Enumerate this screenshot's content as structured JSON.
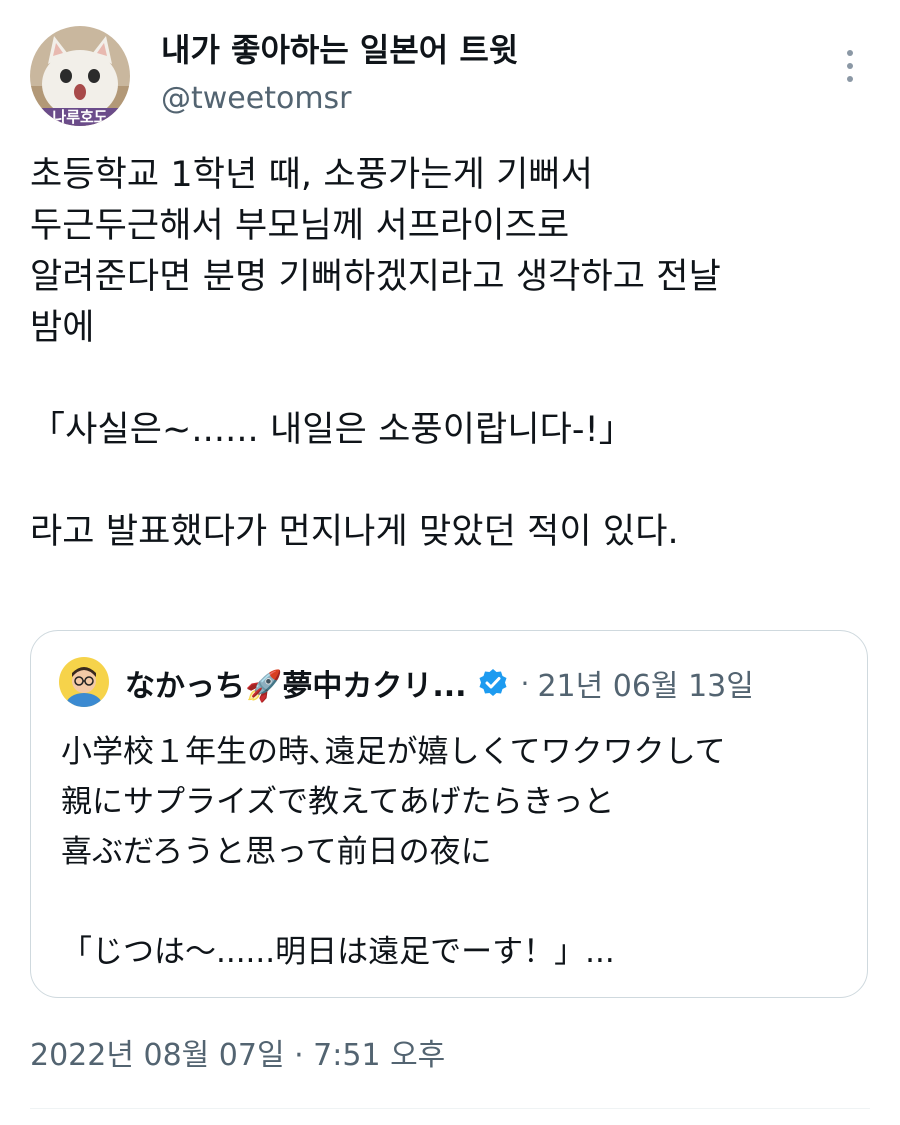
{
  "author": {
    "display_name": "내가 좋아하는 일본어 트윗",
    "handle": "@tweetomsr",
    "avatar_icon": "white-cat-avatar-icon",
    "avatar_overlay_text": "나루호도"
  },
  "more_icon": "vertical-ellipsis-icon",
  "tweet": {
    "text": "초등학교 1학년 때, 소풍가는게 기뻐서\n두근두근해서 부모님께 서프라이즈로\n알려준다면 분명 기뻐하겠지라고 생각하고 전날\n밤에\n\n「사실은~...... 내일은 소풍이랍니다-!」\n\n라고 발표했다가 먼지나게 맞았던 적이 있다.",
    "timestamp": "2022년 08월 07일 · 7:51 오후"
  },
  "quoted_tweet": {
    "author_name": "なかっち🚀夢中カクリ...",
    "avatar_icon": "person-with-glasses-avatar-icon",
    "verified_icon": "verified-badge-icon",
    "separator": "·",
    "date": "21년 06월 13일",
    "text": "小学校１年生の時､遠足が嬉しくてワクワクして\n親にサプライズで教えてあげたらきっと\n喜ぶだろうと思って前日の夜に\n\n「じつは～......明日は遠足でーす！」..."
  },
  "colors": {
    "text_primary": "#0f1419",
    "text_secondary": "#536471",
    "border": "#cfd9de",
    "verified_blue": "#1d9bf0"
  }
}
